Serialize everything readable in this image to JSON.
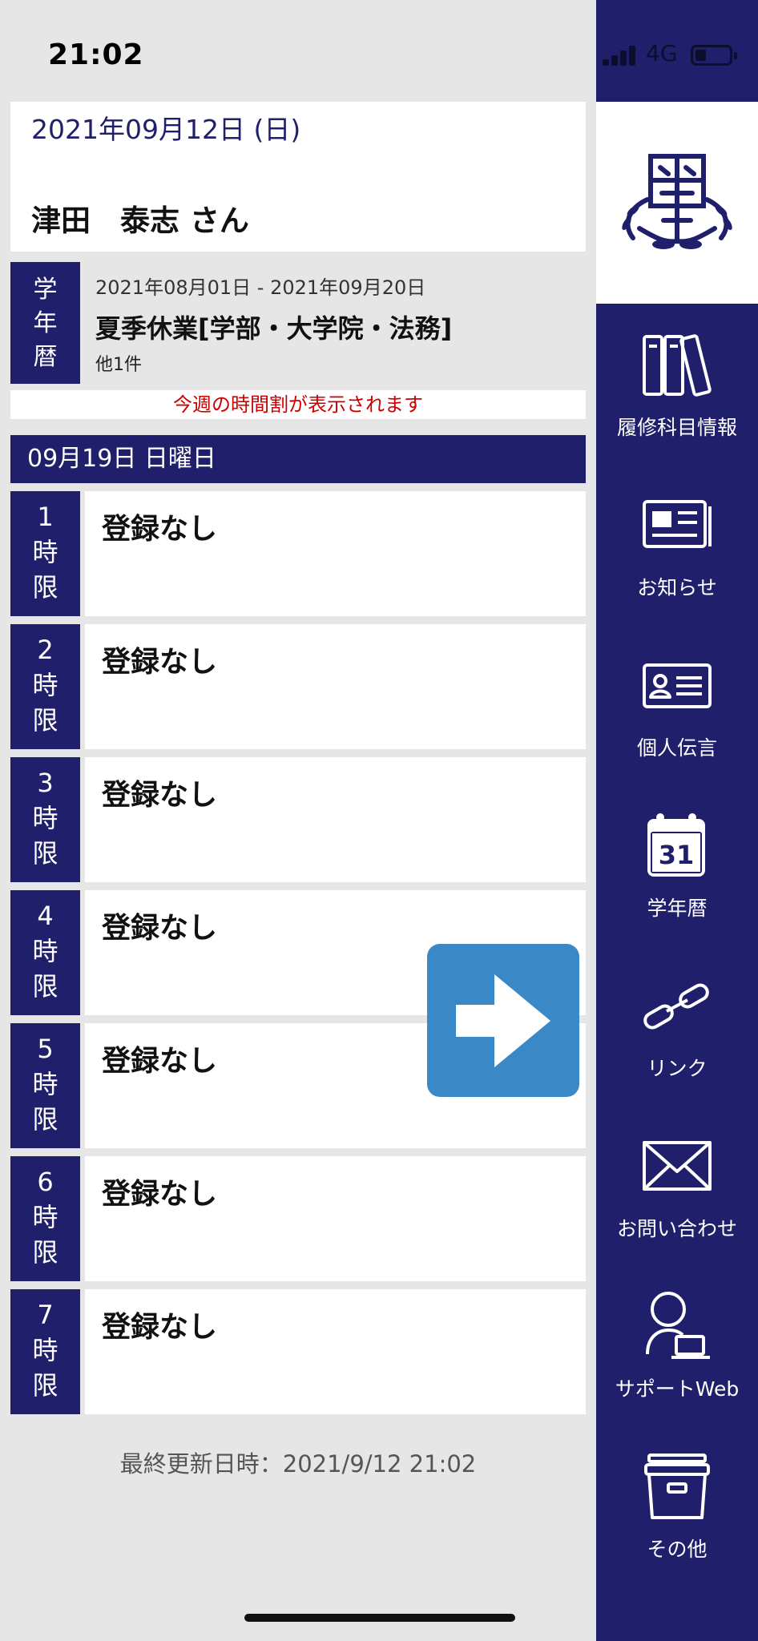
{
  "status_bar": {
    "time": "21:02",
    "network": "4G"
  },
  "header": {
    "date": "2021年09月12日 (日)",
    "user_name": "津田　泰志 さん"
  },
  "calendar": {
    "label": [
      "学",
      "年",
      "暦"
    ],
    "range": "2021年08月01日 - 2021年09月20日",
    "title": "夏季休業[学部・大学院・法務]",
    "more": "他1件"
  },
  "notice": "今週の時間割が表示されます",
  "day_header": "09月19日 日曜日",
  "periods": [
    {
      "number": "1",
      "kanji1": "時",
      "kanji2": "限",
      "text": "登録なし"
    },
    {
      "number": "2",
      "kanji1": "時",
      "kanji2": "限",
      "text": "登録なし"
    },
    {
      "number": "3",
      "kanji1": "時",
      "kanji2": "限",
      "text": "登録なし"
    },
    {
      "number": "4",
      "kanji1": "時",
      "kanji2": "限",
      "text": "登録なし"
    },
    {
      "number": "5",
      "kanji1": "時",
      "kanji2": "限",
      "text": "登録なし"
    },
    {
      "number": "6",
      "kanji1": "時",
      "kanji2": "限",
      "text": "登録なし"
    },
    {
      "number": "7",
      "kanji1": "時",
      "kanji2": "限",
      "text": "登録なし"
    }
  ],
  "next_button": {
    "icon": "arrow-right-icon"
  },
  "last_updated": "最終更新日時：2021/9/12 21:02",
  "sidebar": {
    "logo": "university-crest-icon",
    "items": [
      {
        "label": "履修科目情報",
        "icon": "books-icon"
      },
      {
        "label": "お知らせ",
        "icon": "newspaper-icon"
      },
      {
        "label": "個人伝言",
        "icon": "id-card-icon"
      },
      {
        "label": "学年暦",
        "icon": "calendar-icon",
        "calendar_day": "31"
      },
      {
        "label": "リンク",
        "icon": "link-icon"
      },
      {
        "label": "お問い合わせ",
        "icon": "envelope-icon"
      },
      {
        "label": "サポートWeb",
        "icon": "support-person-icon"
      },
      {
        "label": "その他",
        "icon": "box-icon"
      }
    ]
  },
  "colors": {
    "navy": "#201f6b",
    "accent_blue": "#3b88c6",
    "notice_red": "#cc0000",
    "background": "#e6e6e6"
  }
}
